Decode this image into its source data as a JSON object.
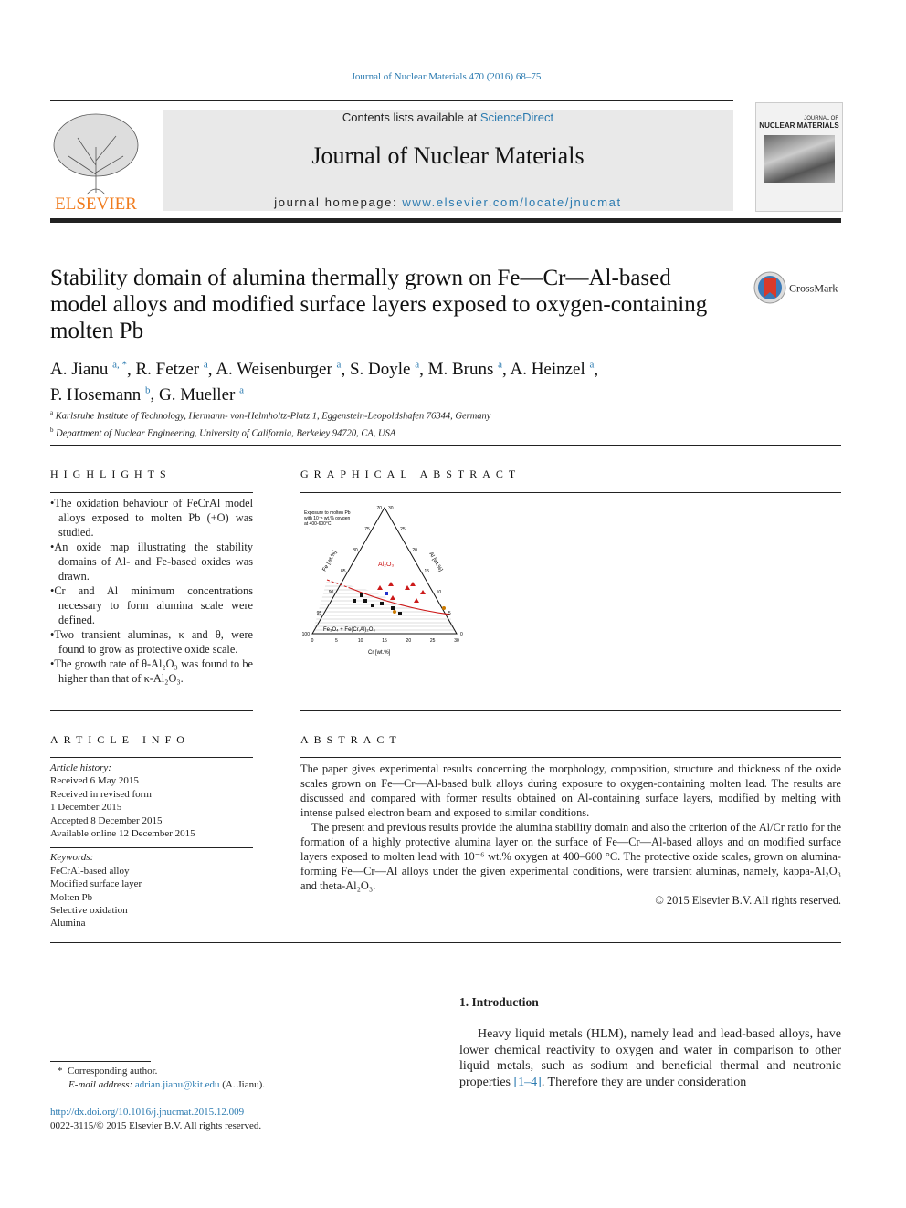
{
  "header": {
    "journal_ref": "Journal of Nuclear Materials 470 (2016) 68–75",
    "contents_prefix": "Contents lists available at ",
    "contents_link": "ScienceDirect",
    "journal_title": "Journal of Nuclear Materials",
    "homepage_prefix": "journal homepage: ",
    "homepage_link": "www.elsevier.com/locate/jnucmat",
    "publisher_logo": "ELSEVIER",
    "cover_title": "NUCLEAR MATERIALS",
    "cover_journal": "JOURNAL OF"
  },
  "article": {
    "title": "Stability domain of alumina thermally grown on Fe—Cr—Al-based model alloys and modified surface layers exposed to oxygen-containing molten Pb",
    "crossmark": "CrossMark",
    "authors": [
      {
        "name": "A. Jianu",
        "sup": "a, *"
      },
      {
        "name": "R. Fetzer",
        "sup": "a"
      },
      {
        "name": "A. Weisenburger",
        "sup": "a"
      },
      {
        "name": "S. Doyle",
        "sup": "a"
      },
      {
        "name": "M. Bruns",
        "sup": "a"
      },
      {
        "name": "A. Heinzel",
        "sup": "a"
      },
      {
        "name": "P. Hosemann",
        "sup": "b"
      },
      {
        "name": "G. Mueller",
        "sup": "a"
      }
    ],
    "affiliations": [
      {
        "sup": "a",
        "text": "Karlsruhe Institute of Technology, Hermann- von-Helmholtz-Platz 1, Eggenstein-Leopoldshafen 76344, Germany"
      },
      {
        "sup": "b",
        "text": "Department of Nuclear Engineering, University of California, Berkeley 94720, CA, USA"
      }
    ]
  },
  "highlights": {
    "heading": "HIGHLIGHTS",
    "items": [
      "The oxidation behaviour of FeCrAl model alloys exposed to molten Pb (+O) was studied.",
      "An oxide map illustrating the stability domains of Al- and Fe-based oxides was drawn.",
      "Cr and Al minimum concentrations necessary to form alumina scale were defined.",
      "Two transient aluminas, κ and θ, were found to grow as protective oxide scale.",
      "The growth rate of θ-Al₂O₃ was found to be higher than that of κ-Al₂O₃."
    ]
  },
  "graphical_abstract": {
    "heading": "GRAPHICAL ABSTRACT",
    "note": [
      "Exposure to molten Pb",
      "with 10⁻⁶ wt.% oxygen",
      "at 400-600°C"
    ],
    "fe_axis": "Fe [wt.%]",
    "al_axis": "Al [wt.%]",
    "cr_axis": "Cr [wt.%]",
    "region_top": "Al₂O₃",
    "region_bottom": "Fe₃O₄ + Fe(Cr,Al)₂O₄",
    "fe_ticks": [
      "70",
      "75",
      "80",
      "85",
      "90",
      "95",
      "100"
    ],
    "al_ticks": [
      "30",
      "25",
      "20",
      "15",
      "10",
      "5",
      "0"
    ],
    "cr_ticks": [
      "0",
      "5",
      "10",
      "15",
      "20",
      "25",
      "30"
    ],
    "colors": {
      "alumina": "#cc1a1a",
      "spinel": "#111111",
      "blue": "#2233cc",
      "orange": "#cc7a00"
    }
  },
  "article_info": {
    "heading": "ARTICLE INFO",
    "history_label": "Article history:",
    "history": [
      "Received 6 May 2015",
      "Received in revised form",
      "1 December 2015",
      "Accepted 8 December 2015",
      "Available online 12 December 2015"
    ],
    "keywords_label": "Keywords:",
    "keywords": [
      "FeCrAl-based alloy",
      "Modified surface layer",
      "Molten Pb",
      "Selective oxidation",
      "Alumina"
    ]
  },
  "abstract": {
    "heading": "ABSTRACT",
    "p1": "The paper gives experimental results concerning the morphology, composition, structure and thickness of the oxide scales grown on Fe—Cr—Al-based bulk alloys during exposure to oxygen-containing molten lead. The results are discussed and compared with former results obtained on Al-containing surface layers, modified by melting with intense pulsed electron beam and exposed to similar conditions.",
    "p2": "The present and previous results provide the alumina stability domain and also the criterion of the Al/Cr ratio for the formation of a highly protective alumina layer on the surface of Fe—Cr—Al-based alloys and on modified surface layers exposed to molten lead with 10⁻⁶ wt.% oxygen at 400–600 °C. The protective oxide scales, grown on alumina-forming Fe—Cr—Al alloys under the given experimental conditions, were transient aluminas, namely, kappa-Al₂O₃ and theta-Al₂O₃.",
    "copyright": "© 2015 Elsevier B.V. All rights reserved."
  },
  "introduction": {
    "heading": "1.  Introduction",
    "text_before": "Heavy liquid metals (HLM), namely lead and lead-based alloys, have lower chemical reactivity to oxygen and water in comparison to other liquid metals, such as sodium and beneficial thermal and neutronic properties ",
    "ref": "[1–4]",
    "text_after": ". Therefore they are under consideration"
  },
  "footnote": {
    "mark": "*",
    "corresponding": "Corresponding author.",
    "email_label": "E-mail address: ",
    "email": "adrian.jianu@kit.edu",
    "email_suffix": " (A. Jianu)."
  },
  "doi": {
    "link": "http://dx.doi.org/10.1016/j.jnucmat.2015.12.009",
    "issn": "0022-3115/© 2015 Elsevier B.V. All rights reserved."
  }
}
